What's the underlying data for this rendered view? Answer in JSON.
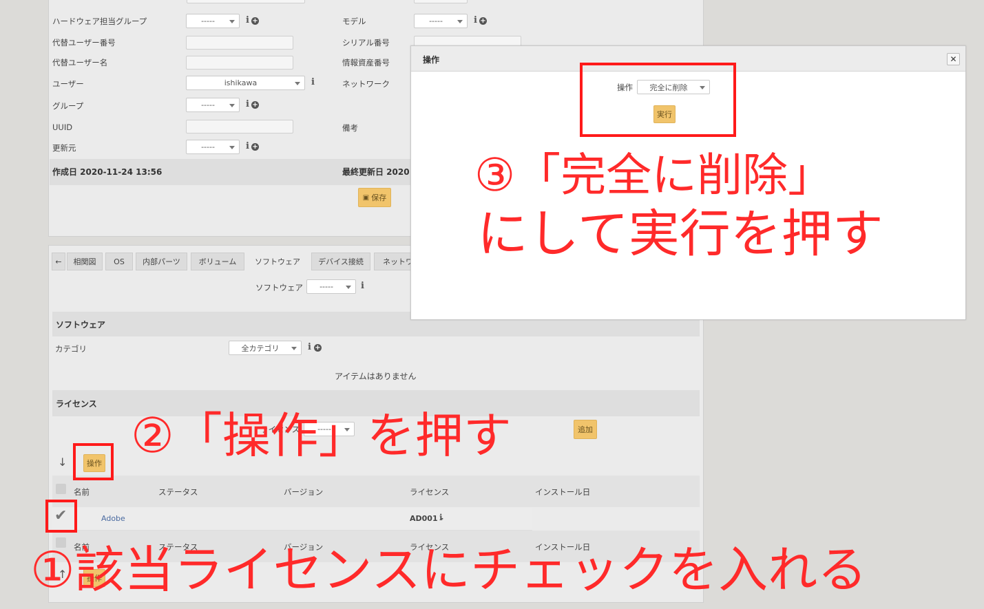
{
  "top_form": {
    "left_fields": [
      {
        "label": "ハードウェア担当グループ",
        "value": "-----"
      },
      {
        "label": "代替ユーザー番号",
        "value": ""
      },
      {
        "label": "代替ユーザー名",
        "value": ""
      },
      {
        "label": "ユーザー",
        "value": "ishikawa"
      },
      {
        "label": "グループ",
        "value": "-----"
      },
      {
        "label": "UUID",
        "value": ""
      },
      {
        "label": "更新元",
        "value": "-----"
      }
    ],
    "right_fields": [
      {
        "label": "モデル",
        "value": "-----"
      },
      {
        "label": "シリアル番号",
        "value": ""
      },
      {
        "label": "情報資産番号",
        "value": ""
      },
      {
        "label": "ネットワーク",
        "value": ""
      },
      {
        "label": "備考",
        "value": ""
      }
    ],
    "created": "作成日 2020-11-24 13:56",
    "updated": "最終更新日 2020",
    "save_label": "保存"
  },
  "tabs": [
    "相関図",
    "OS",
    "内部パーツ",
    "ボリューム",
    "ソフトウェア",
    "デバイス接続",
    "ネットワ"
  ],
  "software_filter": {
    "label": "ソフトウェア",
    "value": "-----"
  },
  "software_section": {
    "title": "ソフトウェア",
    "category_label": "カテゴリ",
    "category_value": "全カテゴリ",
    "empty_text": "アイテムはありません"
  },
  "license_section": {
    "title": "ライセンス",
    "license_label": "ライセンス",
    "license_value": "-----",
    "add_label": "追加",
    "operation_label": "操作",
    "headers": [
      "名前",
      "ステータス",
      "バージョン",
      "ライセンス",
      "インストール日"
    ],
    "rows": [
      {
        "name": "Adobe",
        "license": "AD001 -"
      }
    ]
  },
  "modal": {
    "title": "操作",
    "operation_label": "操作",
    "operation_value": "完全に削除",
    "execute_label": "実行"
  },
  "annotations": {
    "step1": "①該当ライセンスにチェックを入れる",
    "step2": "②「操作」を押す",
    "step3_line1": "③「完全に削除」",
    "step3_line2": "にして実行を押す"
  },
  "colors": {
    "accent_button": "#f1c46b",
    "annotation_red": "#ff1a1a",
    "link": "#4a6aa0"
  }
}
